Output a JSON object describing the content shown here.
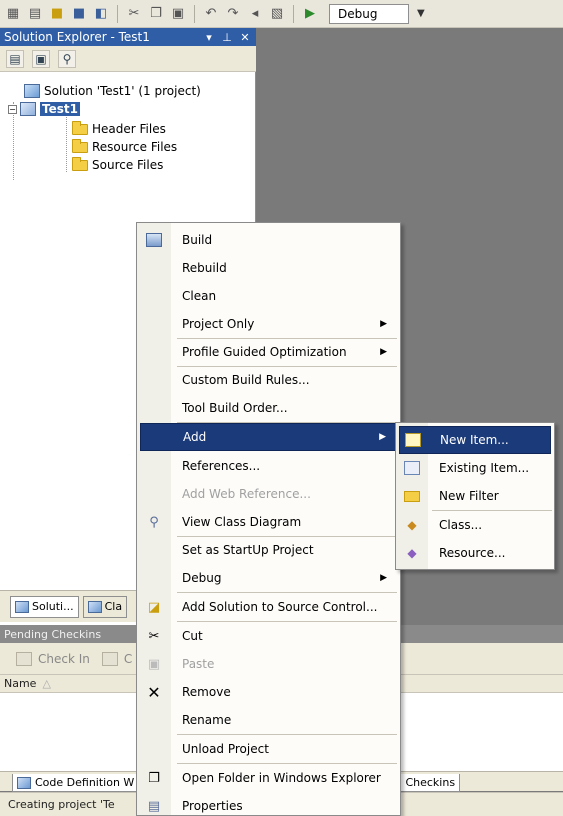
{
  "toolbar": {
    "config_value": "Debug"
  },
  "solution_explorer": {
    "title": "Solution Explorer - Test1",
    "solution_label": "Solution 'Test1' (1 project)",
    "project_label": "Test1",
    "folders": [
      "Header Files",
      "Resource Files",
      "Source Files"
    ],
    "tabs": [
      "Soluti...",
      "Cla"
    ]
  },
  "pending": {
    "header": "Pending Checkins",
    "checkin_label": "Check In",
    "checkin_extra": "C",
    "name_col": "Name"
  },
  "bottom_tabs": [
    "Code Definition W",
    "ng Checkins"
  ],
  "status": "Creating project 'Te",
  "context_menu": {
    "items": [
      {
        "label": "Build",
        "icon": "build-icon"
      },
      {
        "label": "Rebuild"
      },
      {
        "label": "Clean"
      },
      {
        "label": "Project Only",
        "submenu": true
      },
      {
        "label": "Profile Guided Optimization",
        "submenu": true
      },
      {
        "label": "Custom Build Rules..."
      },
      {
        "label": "Tool Build Order..."
      },
      {
        "label": "Add",
        "submenu": true,
        "highlighted": true
      },
      {
        "label": "References..."
      },
      {
        "label": "Add Web Reference...",
        "disabled": true
      },
      {
        "label": "View Class Diagram",
        "icon": "class-diagram-icon"
      },
      {
        "label": "Set as StartUp Project"
      },
      {
        "label": "Debug",
        "submenu": true
      },
      {
        "label": "Add Solution to Source Control...",
        "icon": "source-control-icon"
      },
      {
        "label": "Cut",
        "icon": "cut-icon"
      },
      {
        "label": "Paste",
        "icon": "paste-icon",
        "disabled": true
      },
      {
        "label": "Remove",
        "icon": "remove-icon"
      },
      {
        "label": "Rename"
      },
      {
        "label": "Unload Project"
      },
      {
        "label": "Open Folder in Windows Explorer",
        "icon": "open-folder-icon"
      },
      {
        "label": "Properties",
        "icon": "properties-icon"
      }
    ]
  },
  "add_submenu": {
    "items": [
      {
        "label": "New Item...",
        "icon": "new-item-icon",
        "highlighted": true
      },
      {
        "label": "Existing Item...",
        "icon": "existing-item-icon"
      },
      {
        "label": "New Filter",
        "icon": "new-filter-icon"
      },
      {
        "label": "Class...",
        "icon": "class-icon"
      },
      {
        "label": "Resource...",
        "icon": "resource-icon"
      }
    ]
  }
}
